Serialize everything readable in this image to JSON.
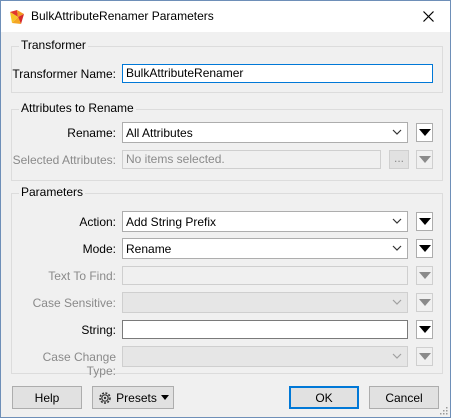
{
  "window": {
    "title": "BulkAttributeRenamer Parameters",
    "icon": "fme-transformer-icon"
  },
  "transformer": {
    "group_title": "Transformer",
    "name_label": "Transformer Name:",
    "name_value": "BulkAttributeRenamer"
  },
  "attributes": {
    "group_title": "Attributes to Rename",
    "rename_label": "Rename:",
    "rename_value": "All Attributes",
    "selected_label": "Selected Attributes:",
    "selected_placeholder": "No items selected.",
    "ellipsis": "..."
  },
  "parameters": {
    "group_title": "Parameters",
    "action_label": "Action:",
    "action_value": "Add String Prefix",
    "mode_label": "Mode:",
    "mode_value": "Rename",
    "text_to_find_label": "Text To Find:",
    "case_sensitive_label": "Case Sensitive:",
    "string_label": "String:",
    "string_value": "",
    "case_change_label": "Case Change Type:"
  },
  "footer": {
    "help_label": "Help",
    "presets_label": "Presets",
    "ok_label": "OK",
    "cancel_label": "Cancel"
  },
  "colors": {
    "accent": "#0078d7",
    "window_bg": "#f0f0f0",
    "disabled_text": "#8a8a8a"
  }
}
